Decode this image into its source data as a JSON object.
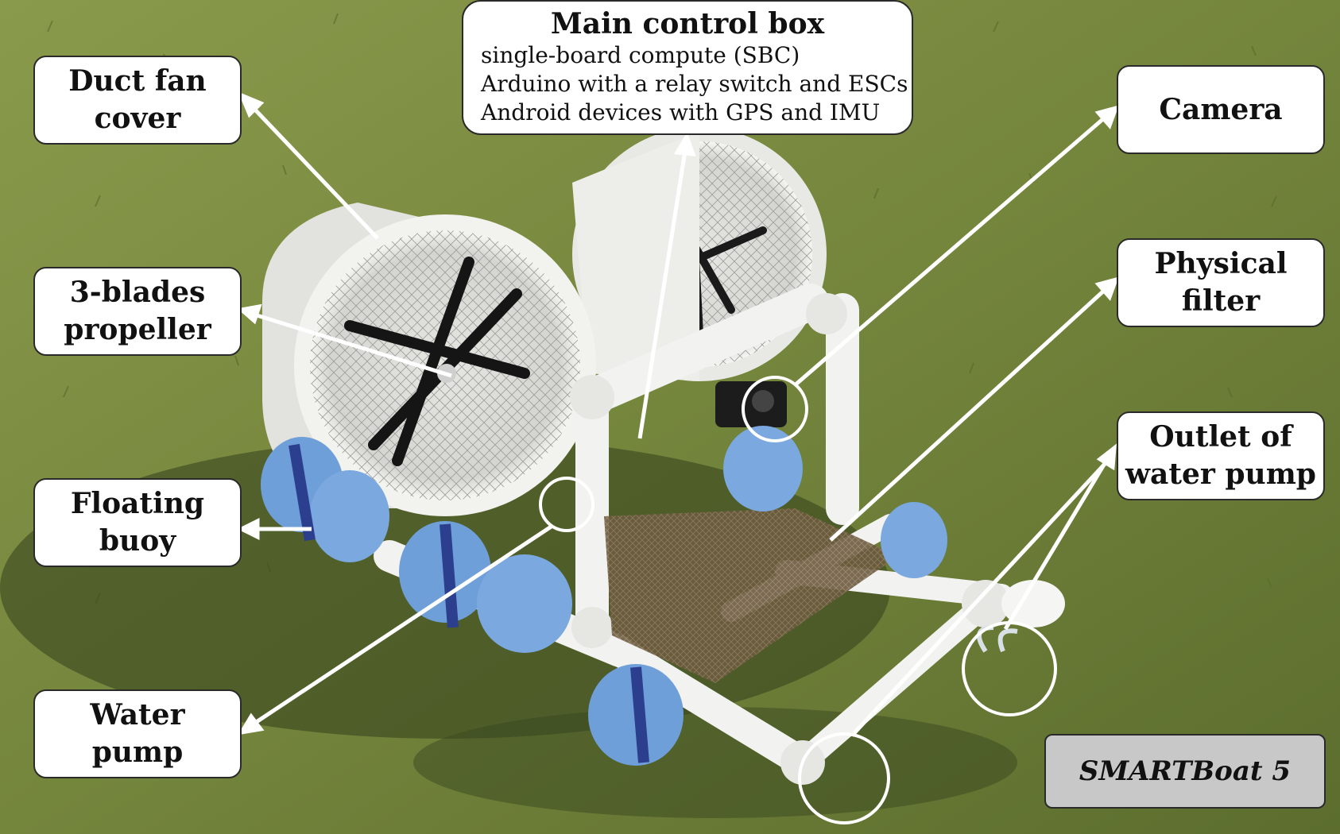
{
  "labels": {
    "duct_fan": [
      "Duct fan",
      "cover"
    ],
    "propeller": [
      "3-blades",
      "propeller"
    ],
    "buoy": [
      "Floating",
      "buoy"
    ],
    "water_pump": [
      "Water",
      "pump"
    ],
    "main_control": {
      "title": "Main control box",
      "lines": [
        "single-board compute (SBC)",
        "Arduino with a relay switch and ESCs",
        "Android devices with GPS and IMU"
      ]
    },
    "camera": [
      "Camera"
    ],
    "filter": [
      "Physical",
      "filter"
    ],
    "outlet": [
      "Outlet of",
      "water pump"
    ],
    "smartboat": "SMARTBoat 5"
  },
  "colors": {
    "grass_light": "#8a9a4c",
    "grass_dark": "#4f5f2a",
    "shadow": "#33401c",
    "pvc": "#f2f2f0",
    "foam_blue": "#6f9fd8",
    "strap": "#2c3f8f",
    "label_bg": "#ffffff",
    "smartboat_bg": "#c8c8c8",
    "arrow": "#ffffff"
  }
}
